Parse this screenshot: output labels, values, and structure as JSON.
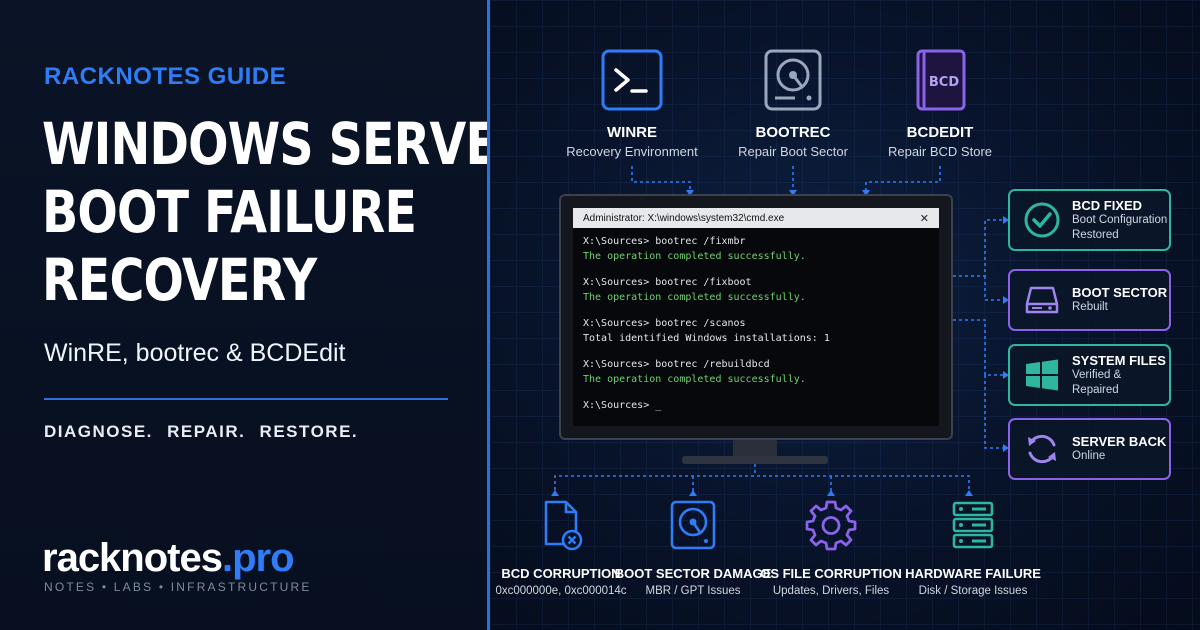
{
  "brand": {
    "kicker": "RACKNOTES GUIDE",
    "title_lines": [
      "WINDOWS SERVER",
      "BOOT FAILURE",
      "RECOVERY"
    ],
    "subtitle": "WinRE, bootrec & BCDEdit",
    "tagline": "DIAGNOSE.  REPAIR.  RESTORE.",
    "logo_main": "racknotes",
    "logo_accent": ".pro",
    "logo_sub": "NOTES • LABS • INFRASTRUCTURE"
  },
  "tools": [
    {
      "icon": "terminal-icon",
      "label": "WINRE",
      "desc": "Recovery Environment"
    },
    {
      "icon": "disk-icon",
      "label": "BOOTREC",
      "desc": "Repair Boot Sector"
    },
    {
      "icon": "book-icon",
      "label": "BCDEDIT",
      "desc": "Repair BCD Store",
      "badge": "BCD"
    }
  ],
  "terminal": {
    "title": "Administrator: X:\\windows\\system32\\cmd.exe",
    "close": "✕",
    "lines": [
      {
        "type": "cmd",
        "text": "X:\\Sources> bootrec /fixmbr"
      },
      {
        "type": "ok",
        "text": "The operation completed successfully."
      },
      {
        "type": "gap",
        "text": ""
      },
      {
        "type": "cmd",
        "text": "X:\\Sources> bootrec /fixboot"
      },
      {
        "type": "ok",
        "text": "The operation completed successfully."
      },
      {
        "type": "gap",
        "text": ""
      },
      {
        "type": "cmd",
        "text": "X:\\Sources> bootrec /scanos"
      },
      {
        "type": "cmd",
        "text": "Total identified Windows installations: 1"
      },
      {
        "type": "gap",
        "text": ""
      },
      {
        "type": "cmd",
        "text": "X:\\Sources> bootrec /rebuildbcd"
      },
      {
        "type": "ok",
        "text": "The operation completed successfully."
      },
      {
        "type": "gap",
        "text": ""
      },
      {
        "type": "cmd",
        "text": "X:\\Sources> _"
      }
    ]
  },
  "results": [
    {
      "icon": "check-circle-icon",
      "title": "BCD FIXED",
      "desc": "Boot Configuration Restored",
      "color": "#2fb6a0"
    },
    {
      "icon": "drive-icon",
      "title": "BOOT SECTOR",
      "desc": "Rebuilt",
      "color": "#8a63e8"
    },
    {
      "icon": "windows-logo-icon",
      "title": "SYSTEM FILES",
      "desc": "Verified & Repaired",
      "color": "#2fb6a0"
    },
    {
      "icon": "refresh-icon",
      "title": "SERVER BACK",
      "desc": "Online",
      "color": "#8a63e8"
    }
  ],
  "issues": [
    {
      "icon": "file-error-icon",
      "title": "BCD CORRUPTION",
      "desc": "0xc000000e, 0xc000014c"
    },
    {
      "icon": "hdd-icon",
      "title": "BOOT SECTOR DAMAGE",
      "desc": "MBR / GPT Issues"
    },
    {
      "icon": "gear-icon",
      "title": "OS FILE CORRUPTION",
      "desc": "Updates, Drivers, Files"
    },
    {
      "icon": "server-icon",
      "title": "HARDWARE FAILURE",
      "desc": "Disk / Storage Issues"
    }
  ],
  "colors": {
    "accent": "#2f7cf6",
    "teal": "#2fb6a0",
    "purple": "#8a63e8",
    "success_text": "#6fd16f"
  }
}
